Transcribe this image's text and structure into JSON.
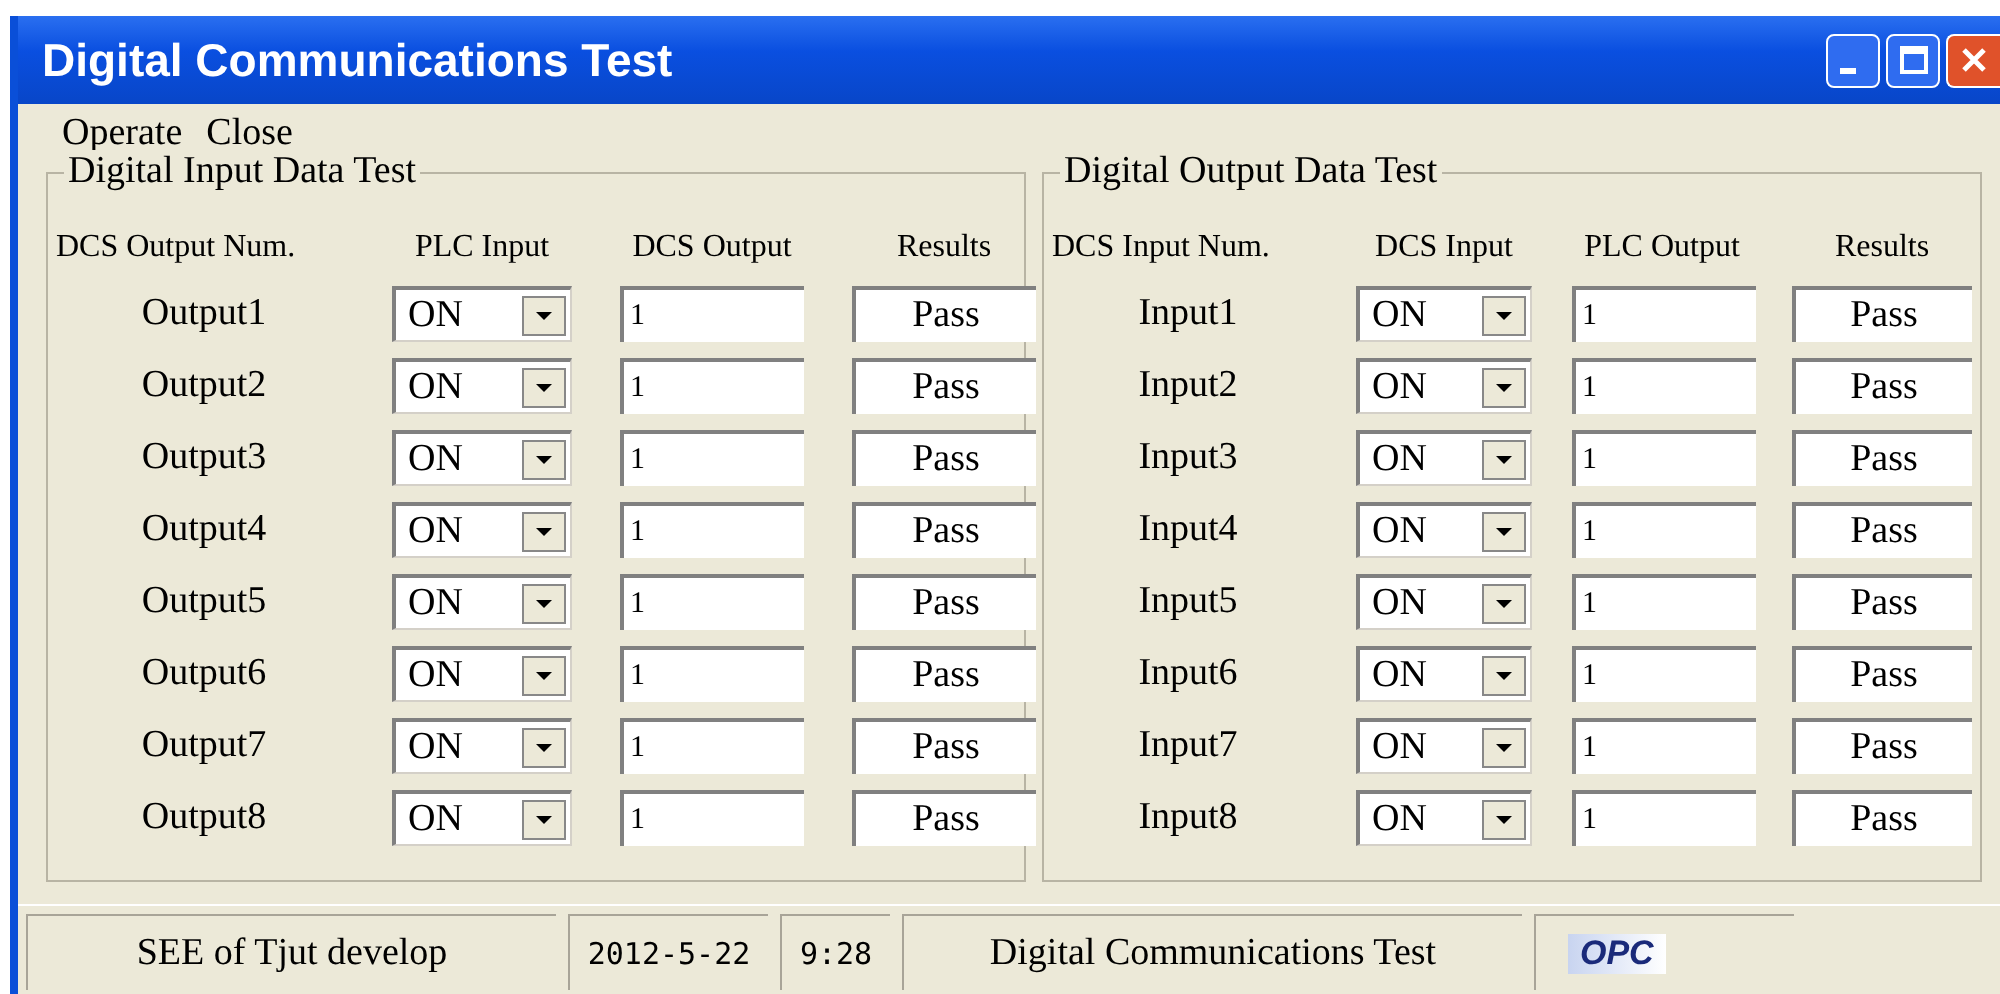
{
  "window": {
    "title": "Digital Communications Test"
  },
  "menu": [
    {
      "label": "Operate"
    },
    {
      "label": "Close"
    }
  ],
  "groups": [
    {
      "title": "Digital Input Data Test",
      "columns": [
        "DCS Output Num.",
        "PLC Input",
        "DCS Output",
        "Results"
      ],
      "rows": [
        {
          "name": "Output1",
          "state": "ON",
          "value": "1",
          "result": "Pass"
        },
        {
          "name": "Output2",
          "state": "ON",
          "value": "1",
          "result": "Pass"
        },
        {
          "name": "Output3",
          "state": "ON",
          "value": "1",
          "result": "Pass"
        },
        {
          "name": "Output4",
          "state": "ON",
          "value": "1",
          "result": "Pass"
        },
        {
          "name": "Output5",
          "state": "ON",
          "value": "1",
          "result": "Pass"
        },
        {
          "name": "Output6",
          "state": "ON",
          "value": "1",
          "result": "Pass"
        },
        {
          "name": "Output7",
          "state": "ON",
          "value": "1",
          "result": "Pass"
        },
        {
          "name": "Output8",
          "state": "ON",
          "value": "1",
          "result": "Pass"
        }
      ]
    },
    {
      "title": "Digital Output Data Test",
      "columns": [
        "DCS Input Num.",
        "DCS Input",
        "PLC Output",
        "Results"
      ],
      "rows": [
        {
          "name": "Input1",
          "state": "ON",
          "value": "1",
          "result": "Pass"
        },
        {
          "name": "Input2",
          "state": "ON",
          "value": "1",
          "result": "Pass"
        },
        {
          "name": "Input3",
          "state": "ON",
          "value": "1",
          "result": "Pass"
        },
        {
          "name": "Input4",
          "state": "ON",
          "value": "1",
          "result": "Pass"
        },
        {
          "name": "Input5",
          "state": "ON",
          "value": "1",
          "result": "Pass"
        },
        {
          "name": "Input6",
          "state": "ON",
          "value": "1",
          "result": "Pass"
        },
        {
          "name": "Input7",
          "state": "ON",
          "value": "1",
          "result": "Pass"
        },
        {
          "name": "Input8",
          "state": "ON",
          "value": "1",
          "result": "Pass"
        }
      ]
    }
  ],
  "status_bar": {
    "author": "SEE of Tjut develop",
    "date": "2012-5-22",
    "time": "9:28",
    "app": "Digital Communications Test",
    "logo": "OPC"
  }
}
